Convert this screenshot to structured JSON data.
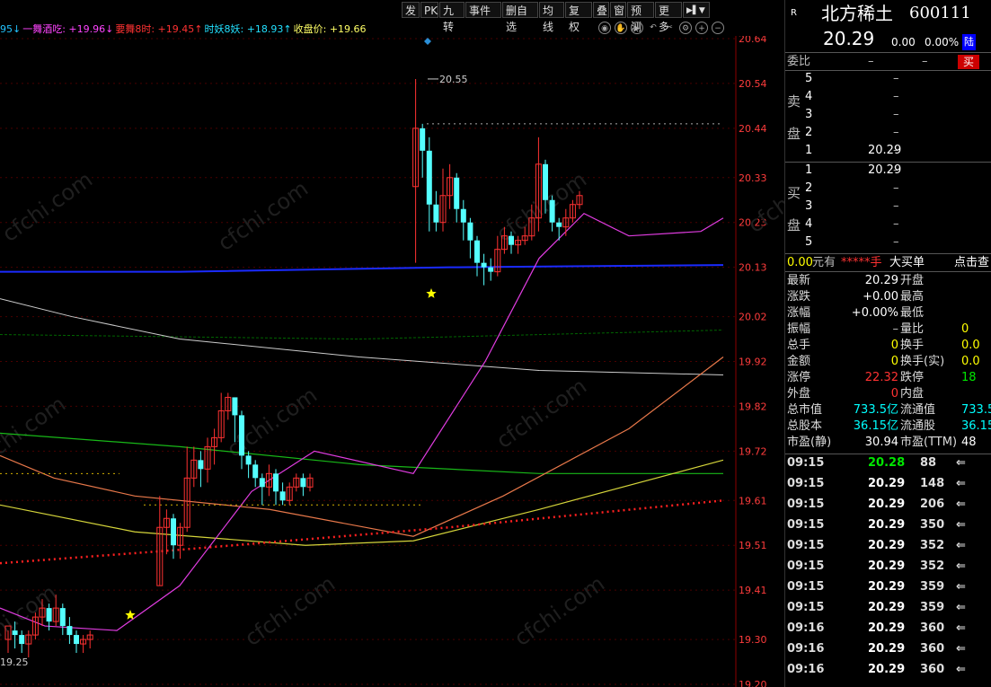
{
  "toolbar": {
    "buttons": [
      {
        "label": "发"
      },
      {
        "label": "PK"
      },
      {
        "label": "九转"
      },
      {
        "label": "事件"
      },
      {
        "label": "删自选"
      },
      {
        "label": "均线"
      },
      {
        "label": "复权"
      },
      {
        "label": "叠"
      },
      {
        "label": "窗"
      },
      {
        "label": "预测"
      },
      {
        "label": "更多"
      }
    ]
  },
  "indicators": [
    {
      "text": "95↓",
      "color": "#22c3ff"
    },
    {
      "text": "一舞酒吃: +19.96↓",
      "color": "#ff44ff"
    },
    {
      "text": "要舞8时: +19.45↑",
      "color": "#ff3232"
    },
    {
      "text": "时妖8妖: +18.93↑",
      "color": "#22e0ff"
    },
    {
      "text": "收盘价: +19.66",
      "color": "#ffff66"
    }
  ],
  "price_axis": [
    "20.64",
    "20.54",
    "20.44",
    "20.33",
    "20.23",
    "20.13",
    "20.02",
    "19.92",
    "19.82",
    "19.72",
    "19.61",
    "19.51",
    "19.41",
    "19.30",
    "19.20"
  ],
  "chart_labels": {
    "high_label": "20.55",
    "low_label": "19.25"
  },
  "watermark": "cfchi.com",
  "stock": {
    "r_tag": "R",
    "name": "北方稀土",
    "code": "600111",
    "price": "20.29",
    "change": "0.00",
    "pct": "0.00%",
    "tag": "陆"
  },
  "weibi": {
    "label": "委比",
    "v1": "–",
    "v2": "–",
    "v3": "–",
    "btn": "买"
  },
  "sell_side": {
    "c1": "卖",
    "c2": "盘"
  },
  "buy_side": {
    "c1": "买",
    "c2": "盘"
  },
  "sell_orders": [
    {
      "lvl": "5",
      "price": "",
      "vol": "–"
    },
    {
      "lvl": "4",
      "price": "",
      "vol": "–"
    },
    {
      "lvl": "3",
      "price": "",
      "vol": "–"
    },
    {
      "lvl": "2",
      "price": "",
      "vol": "–"
    },
    {
      "lvl": "1",
      "price": "20.29",
      "vol": "–"
    }
  ],
  "buy_orders": [
    {
      "lvl": "1",
      "price": "20.29",
      "vol": "–"
    },
    {
      "lvl": "2",
      "price": "",
      "vol": "–"
    },
    {
      "lvl": "3",
      "price": "",
      "vol": "–"
    },
    {
      "lvl": "4",
      "price": "",
      "vol": "–"
    },
    {
      "lvl": "5",
      "price": "",
      "vol": "–"
    }
  ],
  "big_bar": {
    "a": "0.00",
    "b": "元有",
    "c": "*****手",
    "d": "大买单",
    "e": "点击查"
  },
  "stats": [
    {
      "l1": "最新",
      "v1": "20.29",
      "l2": "开盘",
      "v2": ""
    },
    {
      "l1": "涨跌",
      "v1": "+0.00",
      "l2": "最高",
      "v2": ""
    },
    {
      "l1": "涨幅",
      "v1": "+0.00%",
      "l2": "最低",
      "v2": ""
    },
    {
      "l1": "振幅",
      "v1": "–",
      "l2": "量比",
      "v2": "0"
    },
    {
      "l1": "总手",
      "v1": "0",
      "l2": "换手",
      "v2": "0.0"
    },
    {
      "l1": "金额",
      "v1": "0",
      "l2": "换手(实)",
      "v2": "0.0"
    },
    {
      "l1": "涨停",
      "v1": "22.32",
      "l2": "跌停",
      "v2": "18"
    },
    {
      "l1": "外盘",
      "v1": "0",
      "l2": "内盘",
      "v2": ""
    },
    {
      "l1": "总市值",
      "v1": "733.5亿",
      "l2": "流通值",
      "v2": "733.5"
    },
    {
      "l1": "总股本",
      "v1": "36.15亿",
      "l2": "流通股",
      "v2": "36.15"
    },
    {
      "l1": "市盈(静)",
      "v1": "30.94",
      "l2": "市盈(TTM)",
      "v2": "48"
    }
  ],
  "ticks": [
    {
      "time": "09:15",
      "price": "20.28",
      "vol": "88"
    },
    {
      "time": "09:15",
      "price": "20.29",
      "vol": "148"
    },
    {
      "time": "09:15",
      "price": "20.29",
      "vol": "206"
    },
    {
      "time": "09:15",
      "price": "20.29",
      "vol": "350"
    },
    {
      "time": "09:15",
      "price": "20.29",
      "vol": "352"
    },
    {
      "time": "09:15",
      "price": "20.29",
      "vol": "352"
    },
    {
      "time": "09:15",
      "price": "20.29",
      "vol": "359"
    },
    {
      "time": "09:15",
      "price": "20.29",
      "vol": "359"
    },
    {
      "time": "09:16",
      "price": "20.29",
      "vol": "360"
    },
    {
      "time": "09:16",
      "price": "20.29",
      "vol": "360"
    },
    {
      "time": "09:16",
      "price": "20.29",
      "vol": "360"
    }
  ],
  "candles": [
    [
      19.3,
      19.33,
      19.27,
      19.32
    ],
    [
      19.32,
      19.31,
      19.28,
      19.34
    ],
    [
      19.31,
      19.29,
      19.27,
      19.32
    ],
    [
      19.29,
      19.31,
      19.26,
      19.32
    ],
    [
      19.31,
      19.35,
      19.3,
      19.36
    ],
    [
      19.35,
      19.37,
      19.33,
      19.39
    ],
    [
      19.37,
      19.34,
      19.32,
      19.38
    ],
    [
      19.34,
      19.37,
      19.33,
      19.4
    ],
    [
      19.37,
      19.33,
      19.31,
      19.38
    ],
    [
      19.33,
      19.31,
      19.29,
      19.35
    ],
    [
      19.31,
      19.29,
      19.27,
      19.32
    ],
    [
      19.29,
      19.3,
      19.27,
      19.31
    ],
    [
      19.3,
      19.31,
      19.28,
      19.32
    ],
    [
      19.42,
      19.55,
      19.42,
      19.62
    ],
    [
      19.55,
      19.57,
      19.49,
      19.59
    ],
    [
      19.57,
      19.51,
      19.48,
      19.58
    ],
    [
      19.51,
      19.55,
      19.48,
      19.56
    ],
    [
      19.55,
      19.66,
      19.54,
      19.73
    ],
    [
      19.66,
      19.7,
      19.64,
      19.73
    ],
    [
      19.7,
      19.68,
      19.64,
      19.72
    ],
    [
      19.68,
      19.73,
      19.65,
      19.75
    ],
    [
      19.73,
      19.75,
      19.69,
      19.77
    ],
    [
      19.75,
      19.81,
      19.74,
      19.85
    ],
    [
      19.81,
      19.84,
      19.79,
      19.85
    ],
    [
      19.84,
      19.8,
      19.74,
      19.84
    ],
    [
      19.8,
      19.71,
      19.68,
      19.81
    ],
    [
      19.71,
      19.69,
      19.66,
      19.72
    ],
    [
      19.69,
      19.66,
      19.64,
      19.7
    ],
    [
      19.66,
      19.64,
      19.6,
      19.67
    ],
    [
      19.64,
      19.67,
      19.62,
      19.69
    ],
    [
      19.67,
      19.63,
      19.6,
      19.68
    ],
    [
      19.63,
      19.61,
      19.6,
      19.65
    ],
    [
      19.61,
      19.64,
      19.6,
      19.65
    ],
    [
      19.64,
      19.66,
      19.63,
      19.67
    ],
    [
      19.66,
      19.64,
      19.62,
      19.67
    ],
    [
      19.64,
      19.66,
      19.63,
      19.67
    ],
    [
      20.31,
      20.44,
      20.14,
      20.55
    ],
    [
      20.44,
      20.39,
      20.33,
      20.45
    ],
    [
      20.39,
      20.27,
      20.21,
      20.42
    ],
    [
      20.27,
      20.23,
      20.21,
      20.3
    ],
    [
      20.23,
      20.29,
      20.21,
      20.35
    ],
    [
      20.29,
      20.33,
      20.26,
      20.36
    ],
    [
      20.33,
      20.26,
      20.23,
      20.34
    ],
    [
      20.26,
      20.23,
      20.19,
      20.28
    ],
    [
      20.23,
      20.19,
      20.15,
      20.24
    ],
    [
      20.19,
      20.14,
      20.11,
      20.2
    ],
    [
      20.14,
      20.13,
      20.09,
      20.16
    ],
    [
      20.13,
      20.12,
      20.1,
      20.15
    ],
    [
      20.12,
      20.17,
      20.11,
      20.2
    ],
    [
      20.17,
      20.2,
      20.16,
      20.22
    ],
    [
      20.2,
      20.18,
      20.16,
      20.21
    ],
    [
      20.18,
      20.19,
      20.16,
      20.2
    ],
    [
      20.19,
      20.2,
      20.18,
      20.22
    ],
    [
      20.2,
      20.24,
      20.19,
      20.27
    ],
    [
      20.24,
      20.36,
      20.21,
      20.42
    ],
    [
      20.36,
      20.28,
      20.25,
      20.37
    ],
    [
      20.28,
      20.23,
      20.21,
      20.29
    ],
    [
      20.23,
      20.22,
      20.19,
      20.24
    ],
    [
      20.22,
      20.24,
      20.2,
      20.26
    ],
    [
      20.24,
      20.27,
      20.23,
      20.28
    ],
    [
      20.27,
      20.29,
      20.26,
      20.3
    ]
  ]
}
